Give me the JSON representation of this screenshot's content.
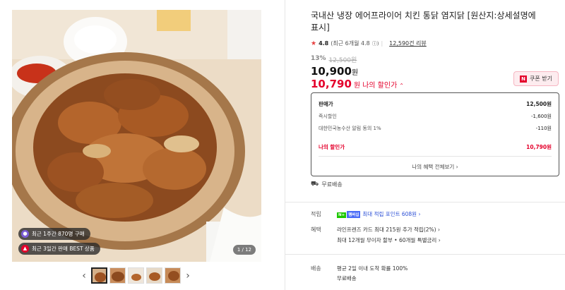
{
  "product": {
    "title": "국내산 냉장 에어프라이어 치킨 통닭 염지닭 [원산지:상세설명에 표시]",
    "rating_score": "4.8",
    "rating_sub": "(최근 6개월 4.8",
    "review_count": "12,590건 리뷰",
    "discount_rate": "13%",
    "original_price": "12,500원",
    "price_num": "10,900",
    "price_unit": "원",
    "my_price_num": "10,790",
    "my_price_unit": "원",
    "my_price_label": "나의 할인가",
    "coupon_label": "쿠폰 받기"
  },
  "image": {
    "badge1": "최근 1주간 870명 구매",
    "badge2": "최근 3일간 판매 BEST 상품",
    "counter": "1 / 12"
  },
  "price_box": {
    "rows": [
      {
        "label": "판매가",
        "value": "12,500원"
      },
      {
        "label": "즉시할인",
        "value": "-1,600원"
      },
      {
        "label": "대한민국농수산 알림 동의 1%",
        "value": "-110원"
      }
    ],
    "my_label": "나의 할인가",
    "my_value": "10,790원",
    "view_all": "나의 혜택 전체보기"
  },
  "shipping_free": "무료배송",
  "info": {
    "point_label": "적립",
    "point_badge1": "N+",
    "point_badge2": "멤버십",
    "point_value": "최대 적립 포인트 608원",
    "benefit_label": "혜택",
    "benefit_line1": "라인프렌즈 카드 최대 215원 추가 적립(2%)",
    "benefit_line2": "최대 12개월 무이자 할부 • 60개월 특별금리",
    "delivery_label": "배송",
    "delivery_line1": "평균 2일 이내 도착 확률 100%",
    "delivery_line2": "무료배송"
  },
  "colors": {
    "accent": "#e4002b",
    "link": "#2b4fd6"
  }
}
